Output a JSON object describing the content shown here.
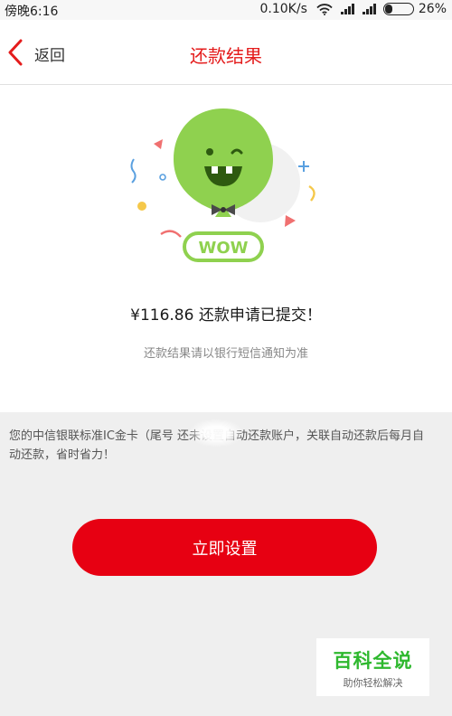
{
  "status_bar": {
    "time": "傍晚6:16",
    "speed": "0.10K/s",
    "battery": "26%",
    "battery_level": 0.26,
    "icons": [
      "wifi-icon",
      "signal-icon",
      "signal-icon",
      "battery-icon"
    ]
  },
  "nav": {
    "back_label": "返回",
    "title": "还款结果",
    "back_icon": "chevron-left-icon"
  },
  "result": {
    "illustration_text": "WOW",
    "amount_message": "¥116.86 还款申请已提交！",
    "hint": "还款结果请以银行短信通知为准"
  },
  "notice": {
    "text": "您的中信银联标准IC金卡（尾号 还未设置自动还款账户，关联自动还款后每月自动还款，省时省力！"
  },
  "actions": {
    "setup_label": "立即设置"
  },
  "watermark": {
    "title": "百科全说",
    "subtitle": "助你轻松解决"
  },
  "colors": {
    "accent_red": "#e70012",
    "title_red": "#e41c1c",
    "balloon_green": "#8fd14f",
    "background": "#efefef"
  }
}
